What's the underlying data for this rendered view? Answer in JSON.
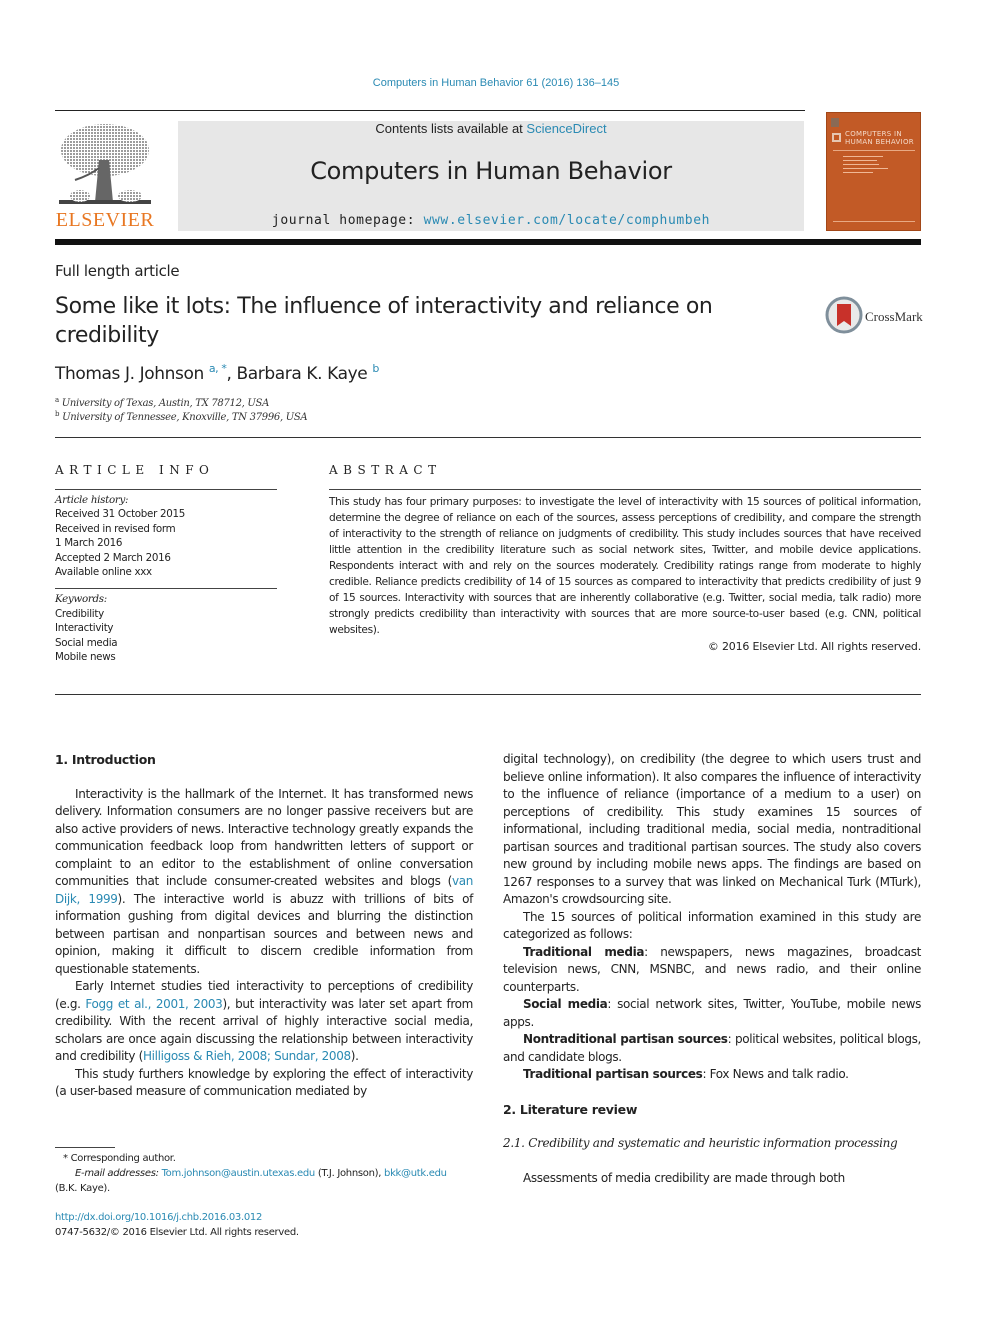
{
  "header": {
    "citation": "Computers in Human Behavior 61 (2016) 136–145",
    "publisher_logo_text": "ELSEVIER",
    "contents_prefix": "Contents lists available at ",
    "contents_link": "ScienceDirect",
    "journal_title": "Computers in Human Behavior",
    "homepage_prefix": "journal homepage: ",
    "homepage_link": "www.elsevier.com/locate/comphumbeh",
    "cover_title_line1": "COMPUTERS IN",
    "cover_title_line2": "HUMAN BEHAVIOR",
    "cover_color": "#c25a26"
  },
  "article": {
    "type": "Full length article",
    "title": "Some like it lots: The influence of interactivity and reliance on credibility",
    "crossmark_label": "CrossMark",
    "authors": [
      {
        "name": "Thomas J. Johnson",
        "sup": "a, *"
      },
      {
        "name": "Barbara K. Kaye",
        "sup": "b"
      }
    ],
    "affiliations": [
      {
        "mark": "a",
        "text": "University of Texas, Austin, TX 78712, USA"
      },
      {
        "mark": "b",
        "text": "University of Tennessee, Knoxville, TN 37996, USA"
      }
    ]
  },
  "article_info": {
    "heading": "ARTICLE INFO",
    "history_label": "Article history:",
    "history": [
      "Received 31 October 2015",
      "Received in revised form",
      "1 March 2016",
      "Accepted 2 March 2016",
      "Available online xxx"
    ],
    "keywords_label": "Keywords:",
    "keywords": [
      "Credibility",
      "Interactivity",
      "Social media",
      "Mobile news"
    ]
  },
  "abstract": {
    "heading": "ABSTRACT",
    "text": "This study has four primary purposes: to investigate the level of interactivity with 15 sources of political information, determine the degree of reliance on each of the sources, assess perceptions of credibility, and compare the strength of interactivity to the strength of reliance on judgments of credibility. This study includes sources that have received little attention in the credibility literature such as social network sites, Twitter, and mobile device applications. Respondents interact with and rely on the sources moderately. Credibility ratings range from moderate to highly credible. Reliance predicts credibility of 14 of 15 sources as compared to interactivity that predicts credibility of just 9 of 15 sources. Interactivity with sources that are inherently collaborative (e.g. Twitter, social media, talk radio) more strongly pre­dicts credibility than interactivity with sources that are more source-to-user based (e.g. CNN, political websites).",
    "copyright": "© 2016 Elsevier Ltd. All rights reserved."
  },
  "body": {
    "sec1_heading": "1.  Introduction",
    "p1_a": "Interactivity is the hallmark of the Internet. It has transformed news delivery. Information consumers are no longer passive re­ceivers but are also active providers of news. Interactive technology greatly expands the communication feedback loop from hand­written letters of support or complaint to an editor to the establish­ment of online conversation communities that include consumer-created websites and blogs (",
    "p1_cite": "van Dijk, 1999",
    "p1_b": "). The interactive world is abuzz with trillions of bits of information gushing from digital devices and blurring the distinction between partisan and non­partisan sources and between news and opinion, making it difficult to discern credible information from questionable statements.",
    "p2_a": "Early Internet studies tied interactivity to perceptions of credi­bility (e.g. ",
    "p2_cite1": "Fogg et al., 2001, 2003",
    "p2_b": "), but interactivity was later set apart from credibility. With the recent arrival of highly interactive social media, scholars are once again discussing the relationship between interactivity and credibility (",
    "p2_cite2": "Hilligoss & Rieh, 2008; Sundar, 2008",
    "p2_c": ").",
    "p3": "This study furthers knowledge by exploring the effect of inter­activity (a user-based measure of communication mediated by",
    "p3_cont": "digital technology), on credibility (the degree to which users trust and believe online information). It also compares the influence of interactivity to the influence of reliance (importance of a medium to a user) on perceptions of credibility. This study examines 15 sources of informational, including traditional media, social media, nontraditional partisan sources and traditional partisan sources. The study also covers new ground by including mobile news apps. The findings are based on 1267 responses to a survey that was linked on Mechanical Turk (MTurk), Amazon's crowdsourcing site.",
    "p4": "The 15 sources of political information examined in this study are categorized as follows:",
    "categories": [
      {
        "label": "Traditional media",
        "text": ": newspapers, news magazines, broadcast television news, CNN, MSNBC, and news radio, and their online counterparts."
      },
      {
        "label": "Social media",
        "text": ": social network sites, Twitter, YouTube, mobile news apps."
      },
      {
        "label": "Nontraditional partisan sources",
        "text": ": political websites, political blogs, and candidate blogs."
      },
      {
        "label": "Traditional partisan sources",
        "text": ": Fox News and talk radio."
      }
    ],
    "sec2_heading": "2.  Literature review",
    "sec21_heading": "2.1.  Credibility and systematic and heuristic information processing",
    "p5": "Assessments of media credibility are made through both"
  },
  "footnotes": {
    "corresponding": "* Corresponding author.",
    "email_label": "E-mail addresses: ",
    "email1": "Tom.johnson@austin.utexas.edu",
    "email1_who": " (T.J. Johnson), ",
    "email2": "bkk@utk.edu",
    "email2_who": "(B.K. Kaye).",
    "doi": "http://dx.doi.org/10.1016/j.chb.2016.03.012",
    "issn": "0747-5632/© 2016 Elsevier Ltd. All rights reserved."
  }
}
